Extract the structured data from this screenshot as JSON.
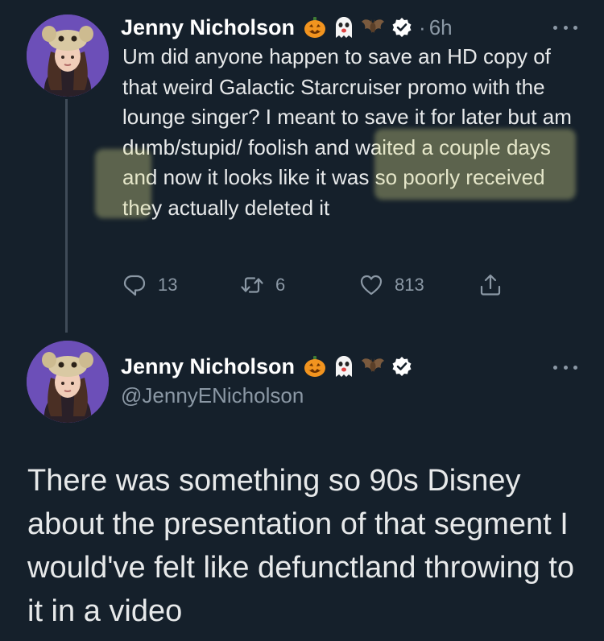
{
  "tweet1": {
    "author": {
      "display_name": "Jenny Nicholson",
      "emojis": [
        "jack-o-lantern-emoji",
        "ghost-emoji",
        "bat-emoji"
      ],
      "verified": true
    },
    "separator": "·",
    "time": "6h",
    "text": "Um did anyone happen to save an HD copy of that weird Galactic Starcruiser promo with the lounge singer? I meant to save it for later but am dumb/stupid/ foolish and waited a couple days and now it looks like it was so poorly received they actually deleted it",
    "actions": {
      "reply_count": "13",
      "retweet_count": "6",
      "like_count": "813"
    },
    "icons": [
      "reply-icon",
      "retweet-icon",
      "like-icon",
      "share-icon",
      "more-icon"
    ]
  },
  "tweet2": {
    "author": {
      "display_name": "Jenny Nicholson",
      "handle": "@JennyENicholson",
      "emojis": [
        "jack-o-lantern-emoji",
        "ghost-emoji",
        "bat-emoji"
      ],
      "verified": true
    },
    "text": "There was something so 90s Disney about the presentation of that segment I would've felt like defunctland throwing to it in a video"
  },
  "colors": {
    "background": "#15202b",
    "text": "#e7e9ea",
    "secondary": "#8b98a5",
    "thread_line": "#3f4b58",
    "highlight": "#e1e18c"
  }
}
